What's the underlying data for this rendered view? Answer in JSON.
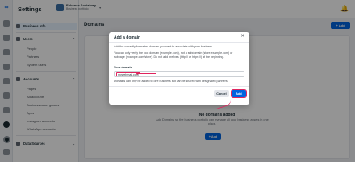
{
  "topbar": {
    "title": "Settings",
    "account_name": "Enhance Socialway",
    "account_sub": "Business portfolio",
    "chevron": "▾",
    "bell_icon": "🔔"
  },
  "rail": {
    "logo": "∞"
  },
  "sidebar": {
    "items": [
      {
        "label": "Business info",
        "kind": "section"
      },
      {
        "label": "Users",
        "kind": "section",
        "chevron": "⌃"
      },
      {
        "label": "People",
        "kind": "sub"
      },
      {
        "label": "Partners",
        "kind": "sub"
      },
      {
        "label": "System users",
        "kind": "sub"
      },
      {
        "label": "Accounts",
        "kind": "section",
        "chevron": "⌃"
      },
      {
        "label": "Pages",
        "kind": "sub"
      },
      {
        "label": "Ad accounts",
        "kind": "sub"
      },
      {
        "label": "Business asset groups",
        "kind": "sub"
      },
      {
        "label": "Apps",
        "kind": "sub"
      },
      {
        "label": "Instagram accounts",
        "kind": "sub"
      },
      {
        "label": "WhatsApp accounts",
        "kind": "sub"
      },
      {
        "label": "Data Sources",
        "kind": "section",
        "chevron": "⌄"
      }
    ]
  },
  "main": {
    "title": "Domains",
    "add_label": "+ Add",
    "empty_title": "No domains added",
    "empty_desc": "Add Domains so the business portfolio can manage all your business assets in one place.",
    "empty_add_label": "+ Add"
  },
  "modal": {
    "title": "Add a domain",
    "close_icon": "✕",
    "p1": "Add the correctly formatted domain you want to associate with your business.",
    "p2": "You can only verify the root domain (example.com), not a subdomain (store.example.com) or subpage (example.com/store). Do not add prefixes (http:// or https://) at the beginning.",
    "field_label": "Your domain",
    "field_value": "mywebmail.com",
    "note": "Domains can only be added to one business but can be shared with designated partners.",
    "cancel_label": "Cancel",
    "add_label": "Add"
  },
  "colors": {
    "accent": "#0064e0",
    "annotation": "#e0245e",
    "overlay": "rgba(0,0,0,0.42)"
  }
}
